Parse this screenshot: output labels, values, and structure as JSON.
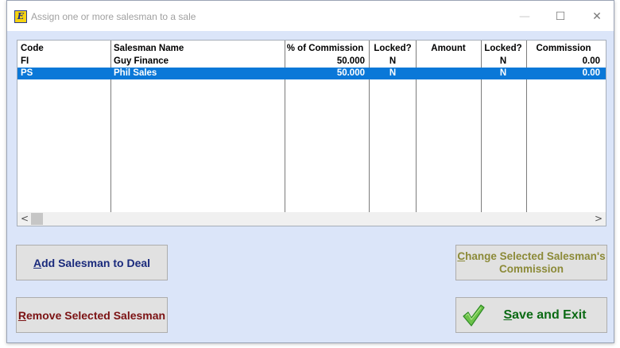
{
  "window": {
    "title": "Assign one or more salesman to a sale",
    "icon_glyph": "E",
    "controls": {
      "minimize": "—",
      "maximize": "☐",
      "close": "✕"
    }
  },
  "table": {
    "columns": [
      "Code",
      "Salesman Name",
      "% of Commission",
      "Locked?",
      "Amount",
      "Locked?",
      "Commission"
    ],
    "rows": [
      {
        "code": "FI",
        "name": "Guy Finance",
        "pct": "50.000",
        "locked1": "N",
        "amount": "",
        "locked2": "N",
        "commission": "0.00",
        "selected": false
      },
      {
        "code": "PS",
        "name": "Phil Sales",
        "pct": "50.000",
        "locked1": "N",
        "amount": "",
        "locked2": "N",
        "commission": "0.00",
        "selected": true
      }
    ],
    "scroll": {
      "left": "<",
      "right": ">"
    }
  },
  "buttons": {
    "add": {
      "mnemonic": "A",
      "rest": "dd Salesman to Deal"
    },
    "remove": {
      "mnemonic": "R",
      "rest": "emove Selected Salesman"
    },
    "change": {
      "mnemonic": "C",
      "rest_line1": "hange Selected Salesman's",
      "line2": "Commission"
    },
    "save": {
      "mnemonic": "S",
      "rest": "ave and Exit"
    }
  },
  "colors": {
    "selection": "#0a78d8",
    "window_bg": "#dbe5f9",
    "save_text": "#0b6a14",
    "remove_text": "#7b1213",
    "add_text": "#1a2a7c",
    "change_text": "#8c8a38"
  },
  "icons": {
    "app": "app-logo-icon",
    "save": "checkmark-icon"
  }
}
